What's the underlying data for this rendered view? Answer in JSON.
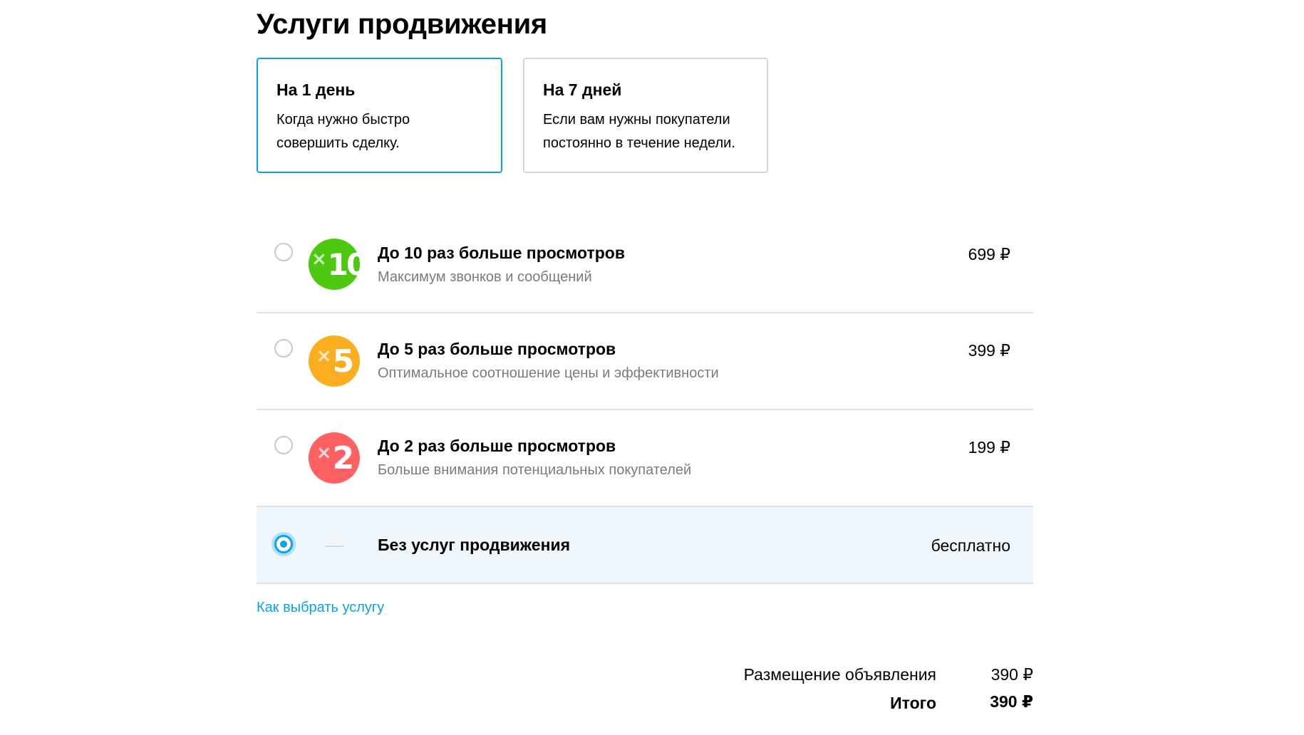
{
  "title": "Услуги продвижения",
  "durations": [
    {
      "title": "На 1 день",
      "desc_line1": "Когда нужно быстро",
      "desc_line2": "совершить сделку.",
      "selected": true
    },
    {
      "title": "На 7 дней",
      "desc_line1": "Если вам нужны покупатели",
      "desc_line2": "постоянно в течение недели.",
      "selected": false
    }
  ],
  "options": [
    {
      "badge_mult": "×",
      "badge_num": "10",
      "badge_color": "#4cc90f",
      "title": "До 10 раз больше просмотров",
      "subtitle": "Максимум звонков и сообщений",
      "price": "699 ₽",
      "selected": false
    },
    {
      "badge_mult": "×",
      "badge_num": "5",
      "badge_color": "#fdad20",
      "title": "До 5 раз больше просмотров",
      "subtitle": "Оптимальное соотношение цены и эффективности",
      "price": "399 ₽",
      "selected": false
    },
    {
      "badge_mult": "×",
      "badge_num": "2",
      "badge_color": "#ff6163",
      "title": "До 2 раз больше просмотров",
      "subtitle": "Больше внимания потенциальных покупателей",
      "price": "199 ₽",
      "selected": false
    },
    {
      "title": "Без услуг продвижения",
      "price": "бесплатно",
      "selected": true
    }
  ],
  "help_link": "Как выбрать услугу",
  "summary": {
    "placement_label": "Размещение объявления",
    "placement_value": "390 ₽",
    "total_label": "Итого",
    "total_value": "390 ₽"
  },
  "colors": {
    "accent": "#0aa1ef",
    "selected_row_bg": "#eff7fc"
  }
}
